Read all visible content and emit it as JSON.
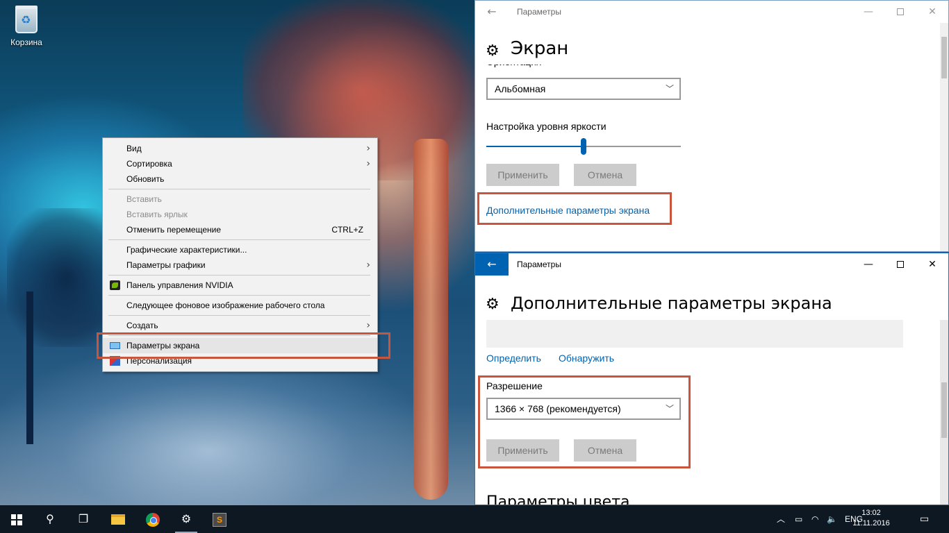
{
  "desktop": {
    "recycle_bin_label": "Корзина"
  },
  "context_menu": {
    "items": [
      {
        "label": "Вид",
        "submenu": true
      },
      {
        "label": "Сортировка",
        "submenu": true
      },
      {
        "label": "Обновить"
      },
      {
        "label": "Вставить",
        "disabled": true
      },
      {
        "label": "Вставить ярлык",
        "disabled": true
      },
      {
        "label": "Отменить перемещение",
        "shortcut": "CTRL+Z"
      },
      {
        "label": "Графические характеристики..."
      },
      {
        "label": "Параметры графики",
        "submenu": true
      },
      {
        "label": "Панель управления NVIDIA",
        "icon": "nvidia-icon"
      },
      {
        "label": "Следующее фоновое изображение рабочего стола"
      },
      {
        "label": "Создать",
        "submenu": true
      },
      {
        "label": "Параметры экрана",
        "icon": "display-icon",
        "highlighted": true
      },
      {
        "label": "Персонализация",
        "icon": "personalization-icon"
      }
    ]
  },
  "window_display": {
    "title": "Параметры",
    "heading": "Экран",
    "orientation_label_partial": "Ориентация",
    "orientation_value": "Альбомная",
    "brightness_label": "Настройка уровня яркости",
    "brightness_percent": 50,
    "apply_label": "Применить",
    "cancel_label": "Отмена",
    "advanced_link": "Дополнительные параметры экрана"
  },
  "window_advanced": {
    "title": "Параметры",
    "heading": "Дополнительные параметры экрана",
    "identify_link": "Определить",
    "detect_link": "Обнаружить",
    "resolution_label": "Разрешение",
    "resolution_value": "1366 × 768 (рекомендуется)",
    "apply_label": "Применить",
    "cancel_label": "Отмена",
    "color_section_partial": "Параметры цвета"
  },
  "taskbar": {
    "language": "ENG",
    "time": "13:02",
    "date": "11.11.2016"
  },
  "colors": {
    "accent": "#0063b1",
    "highlight_box": "#c9553c",
    "taskbar": "#0d1822"
  }
}
